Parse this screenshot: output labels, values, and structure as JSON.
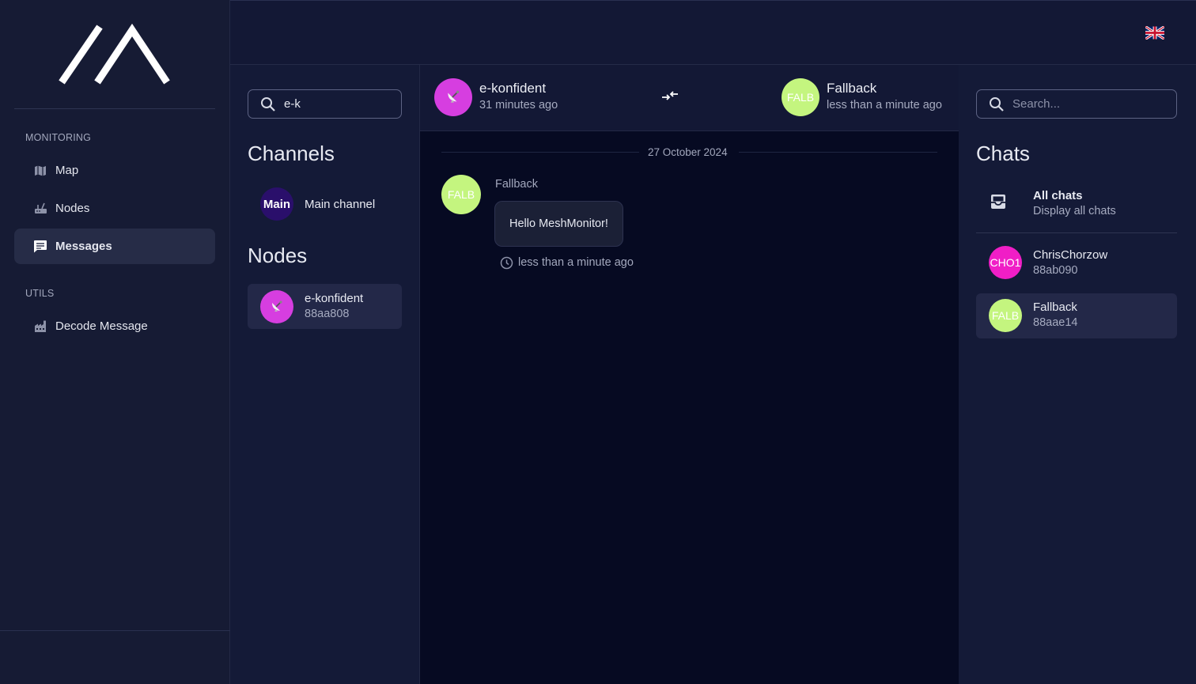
{
  "sidebar": {
    "monitoring_title": "MONITORING",
    "utils_title": "UTILS",
    "items": [
      {
        "label": "Map",
        "icon": "map-icon"
      },
      {
        "label": "Nodes",
        "icon": "router-icon"
      },
      {
        "label": "Messages",
        "icon": "message-icon"
      },
      {
        "label": "Decode Message",
        "icon": "factory-icon"
      }
    ]
  },
  "topbar": {
    "language_icon": "uk-flag-icon"
  },
  "left_panel": {
    "search_value": "e-k",
    "channels_title": "Channels",
    "channels": [
      {
        "avatar": "Main",
        "label": "Main channel",
        "color": "#2a0f6b"
      }
    ],
    "nodes_title": "Nodes",
    "nodes": [
      {
        "label": "e-konfident",
        "sub": "88aa808",
        "color": "#d63ee0",
        "icon": "satellite-dish-icon"
      }
    ]
  },
  "chat_header": {
    "from": {
      "name": "e-konfident",
      "time": "31 minutes ago",
      "color": "#d63ee0"
    },
    "swap_icon": "swap-arrows-icon",
    "to": {
      "avatar": "FALB",
      "name": "Fallback",
      "time": "less than a minute ago",
      "color": "#c4f57f"
    }
  },
  "chat": {
    "date": "27 October 2024",
    "messages": [
      {
        "avatar": "FALB",
        "sender": "Fallback",
        "text": "Hello MeshMonitor!",
        "time": "less than a minute ago",
        "color": "#c4f57f"
      }
    ]
  },
  "right_panel": {
    "search_placeholder": "Search...",
    "title": "Chats",
    "all_chats": {
      "label": "All chats",
      "sub": "Display all chats",
      "icon": "inbox-icon"
    },
    "chats": [
      {
        "avatar": "CHO1",
        "name": "ChrisChorzow",
        "id": "88ab090",
        "color": "#f01ec6"
      },
      {
        "avatar": "FALB",
        "name": "Fallback",
        "id": "88aae14",
        "color": "#c4f57f"
      }
    ]
  },
  "colors": {
    "accent_active": "#262c47",
    "background": "#0a0f2a"
  }
}
